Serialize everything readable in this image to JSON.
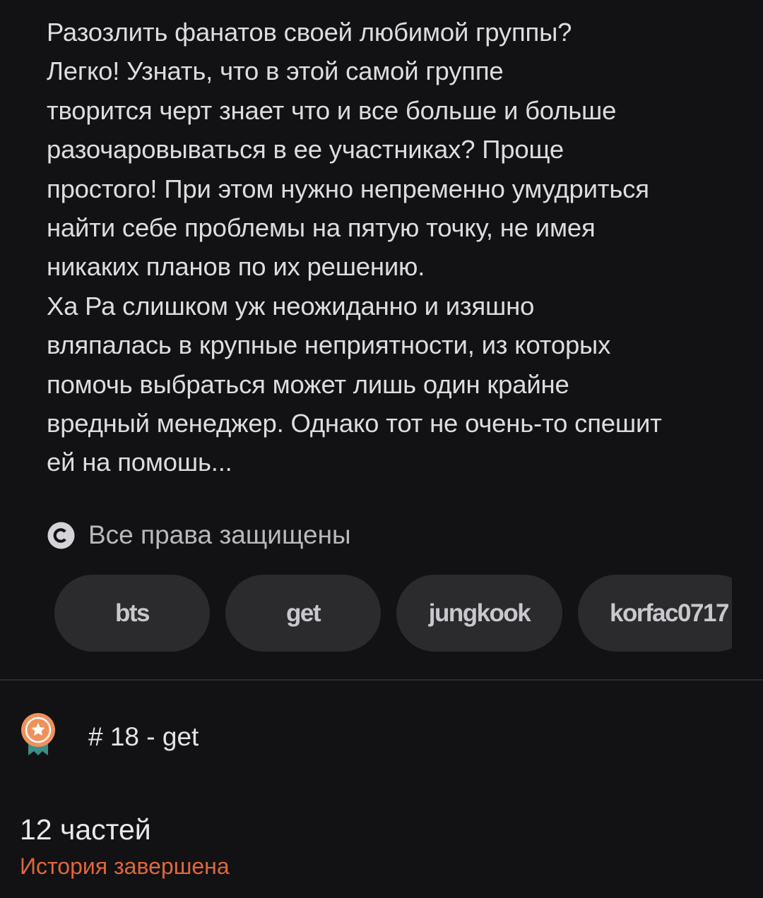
{
  "description": {
    "paragraph1": "Разозлить фанатов своей любимой группы?\nЛегко! Узнать, что в этой самой группе\nтворится черт знает что и  все больше и больше\nразочаровываться в ее участниках? Проще\nпростого! При этом нужно непременно умудриться\nнайти себе проблемы на пятую точку, не имея\nникаких планов по их решению.",
    "paragraph2": "   Ха Ра слишком уж неожиданно и изяшно\nвляпалась в крупные неприятности, из которых\nпомочь выбраться может лишь один крайне\nвредный менеджер. Однако тот не очень-то спешит\nей на помошь..."
  },
  "rights": {
    "icon": "copyright-icon",
    "label": "Все права защищены"
  },
  "tags": [
    {
      "label": "bts"
    },
    {
      "label": "get"
    },
    {
      "label": "jungkook"
    },
    {
      "label": "korfac0717"
    }
  ],
  "rating": {
    "icon": "medal-icon",
    "text": "# 18 - get"
  },
  "parts": {
    "count_label": "12 частей",
    "status_label": "История завершена"
  },
  "colors": {
    "background": "#121113",
    "tag_background": "#2b2a2d",
    "accent_orange": "#e0673a",
    "medal_orange": "#f0915c",
    "ribbon_teal": "#3a8f86"
  }
}
